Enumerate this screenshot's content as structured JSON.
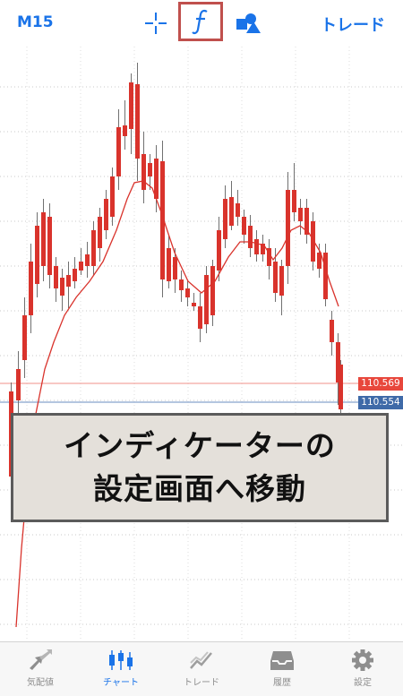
{
  "toolbar": {
    "timeframe": "M15",
    "crosshair_icon": "crosshair-icon",
    "indicator_icon": "function-icon",
    "objects_icon": "shapes-icon",
    "trade_label": "トレード",
    "highlight_color": "#c0504d"
  },
  "chart": {
    "up_color": "#3cb043",
    "down_color": "#d9332c",
    "ma_color": "#d9332c",
    "price_tags": [
      {
        "value": "110.569",
        "color": "#e8473c"
      },
      {
        "value": "110.554",
        "color": "#3f6aa8"
      }
    ]
  },
  "overlay": {
    "line1": "インディケーターの",
    "line2": "設定画面へ移動"
  },
  "tabs": [
    {
      "label": "気配値",
      "icon": "quotes-icon",
      "active": false
    },
    {
      "label": "チャート",
      "icon": "chart-icon",
      "active": true
    },
    {
      "label": "トレード",
      "icon": "trade-icon",
      "active": false
    },
    {
      "label": "履歴",
      "icon": "history-icon",
      "active": false
    },
    {
      "label": "設定",
      "icon": "settings-icon",
      "active": false
    }
  ],
  "colors": {
    "accent": "#1a73e8",
    "inactive": "#8e8e8e"
  }
}
